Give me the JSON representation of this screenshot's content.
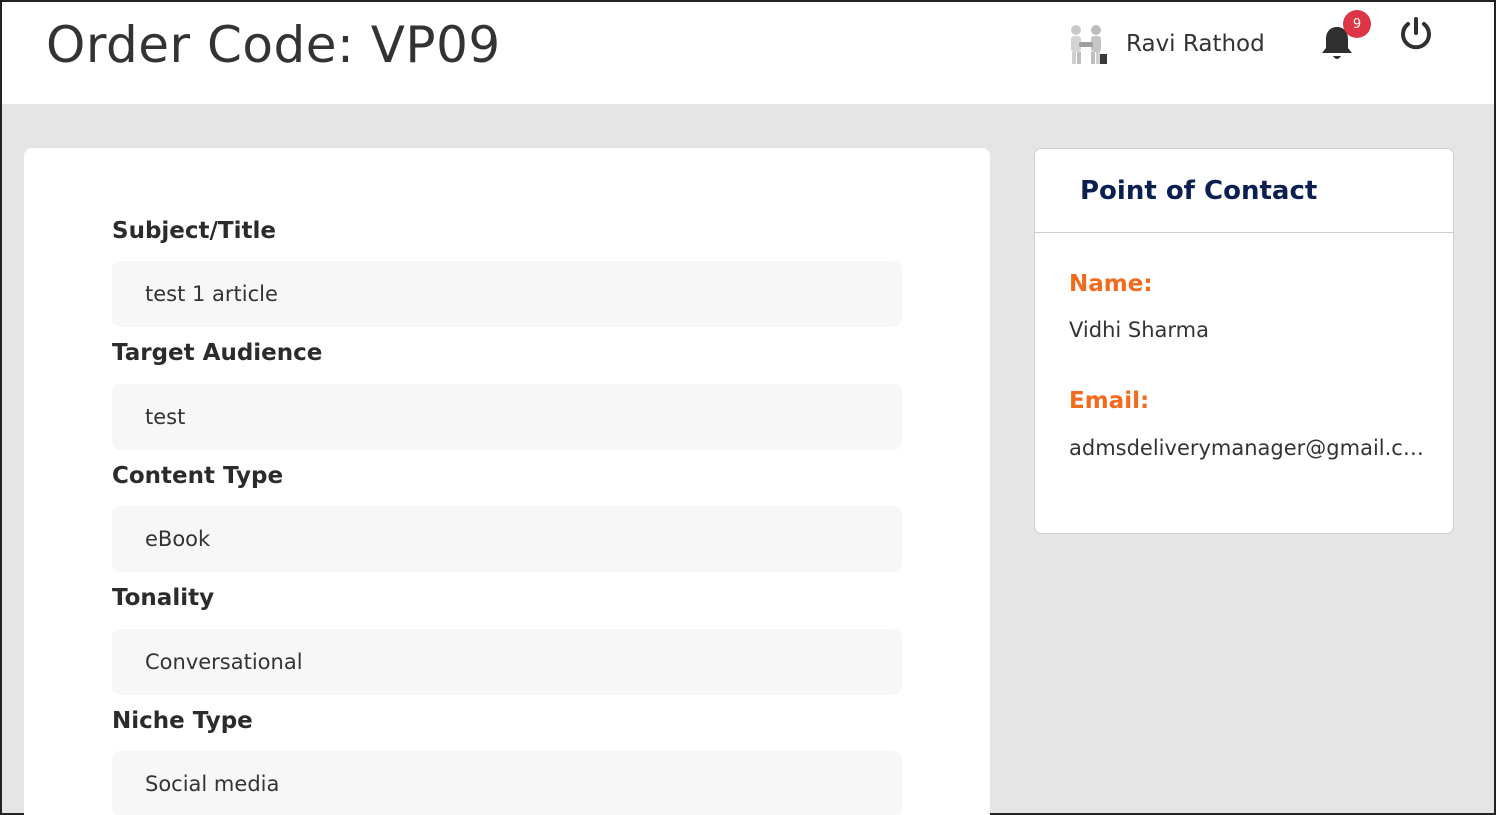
{
  "header": {
    "title": "Order Code: VP09",
    "user_name": "Ravi Rathod",
    "notification_count": "9",
    "avatar_icon": "handshake-avatar-icon",
    "bell_icon": "bell-icon",
    "power_icon": "power-icon"
  },
  "fields": [
    {
      "label": "Subject/Title",
      "value": "test 1 article"
    },
    {
      "label": "Target Audience",
      "value": "test"
    },
    {
      "label": "Content Type",
      "value": "eBook"
    },
    {
      "label": "Tonality",
      "value": "Conversational"
    },
    {
      "label": "Niche Type",
      "value": "Social media"
    }
  ],
  "contact": {
    "title": "Point of Contact",
    "name_label": "Name:",
    "name_value": "Vidhi Sharma",
    "email_label": "Email:",
    "email_value": "admsdeliverymanager@gmail.com"
  },
  "colors": {
    "accent_orange": "#f26b1d",
    "navy": "#0b2050",
    "badge_red": "#dc3545",
    "background": "#e5e5e5"
  }
}
